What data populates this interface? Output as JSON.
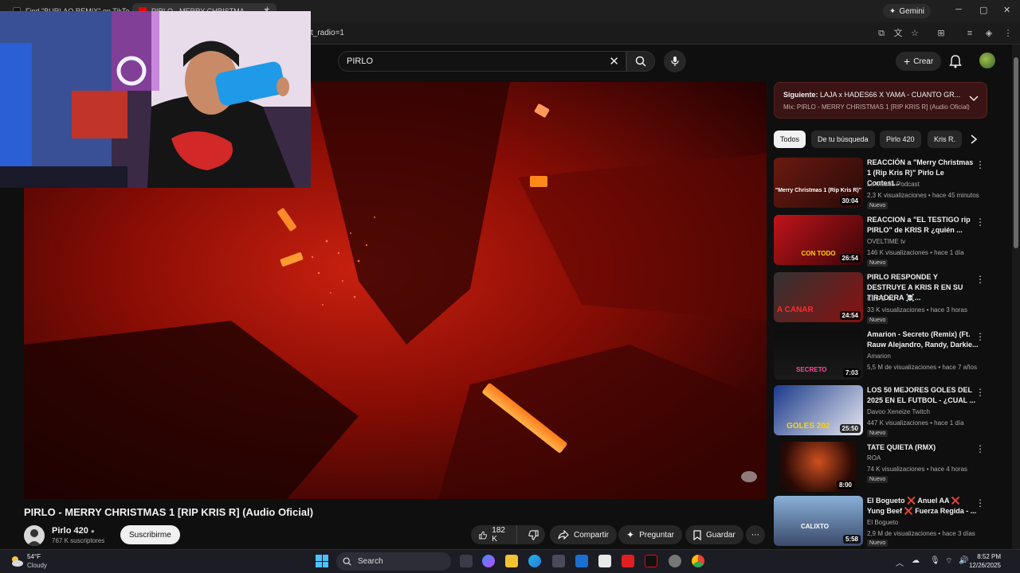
{
  "browser": {
    "tabs": [
      {
        "label": "Find \"BURLAO REMIX\" on TikTo..."
      },
      {
        "label": "PIRLO - MERRY CHRISTMA..."
      }
    ],
    "gemini_label": "Gemini",
    "url_fragment": "t_radio=1"
  },
  "youtube": {
    "search_value": "PIRLO",
    "create_label": "Crear"
  },
  "video": {
    "title": "PIRLO - MERRY CHRISTMAS 1 [RIP KRIS R] (Audio Oficial)",
    "channel_name": "Pirlo 420",
    "subscribers": "767 K suscriptores",
    "subscribe_label": "Suscribirme",
    "likes": "182 K",
    "share_label": "Compartir",
    "ask_label": "Preguntar",
    "save_label": "Guardar"
  },
  "up_next": {
    "prefix": "Siguiente:",
    "title": "LAJA x HADES66 X YAMA - CUANTO GR...",
    "mix": "Mix: PIRLO - MERRY CHRISTMAS 1 [RIP KRIS R] (Audio Oficial)"
  },
  "chips": [
    "Todos",
    "De tu búsqueda",
    "Pirlo 420",
    "Kris R."
  ],
  "recommendations": [
    {
      "title": "REACCIÓN a \"Merry Christmas 1 (Rip Kris R)\" Pirlo Le Contest...",
      "channel": "La Mesita Podcast",
      "meta": "2,3 K visualizaciones • hace 45 minutos",
      "badge": "Nuevo",
      "duration": "30:04",
      "thumb_text": "\"Merry Christmas 1 (Rip Kris R)\""
    },
    {
      "title": "REACCION a \"EL TESTIGO rip PIRLO\" de KRIS R ¿quién ...",
      "channel": "OVELTIME tv",
      "meta": "146 K visualizaciones • hace 1 día",
      "badge": "Nuevo",
      "duration": "26:54",
      "thumb_text": "CON TODO"
    },
    {
      "title": "PIRLO RESPONDE Y DESTRUYE A KRIS R EN SU TIRADERA ☠️...",
      "channel": "CLIPS TC",
      "meta": "33 K visualizaciones • hace 3 horas",
      "badge": "Nuevo",
      "duration": "24:54",
      "thumb_text": "A CANAR"
    },
    {
      "title": "Amarion - Secreto (Remix) (Ft. Rauw Alejandro, Randy, Darkie...",
      "channel": "Amarion",
      "meta": "5,5 M de visualizaciones • hace 7 años",
      "badge": "",
      "duration": "7:03",
      "thumb_text": "SECRETO"
    },
    {
      "title": "LOS 50 MEJORES GOLES DEL 2025 EN EL FUTBOL - ¿CUAL ...",
      "channel": "Davoo Xeneize Twitch",
      "meta": "447 K visualizaciones • hace 1 día",
      "badge": "Nuevo",
      "duration": "25:50",
      "thumb_text": "GOLES 202"
    },
    {
      "title": "TATE QUIETA (RMX)",
      "channel": "ROA",
      "meta": "74 K visualizaciones • hace 4 horas",
      "badge": "Nuevo",
      "duration": "8:00",
      "thumb_text": ""
    },
    {
      "title": "El Bogueto ❌ Anuel AA ❌ Yung Beef ❌ Fuerza Regida - ...",
      "channel": "El Bogueto",
      "meta": "2,9 M de visualizaciones • hace 3 días",
      "badge": "Nuevo",
      "duration": "5:58",
      "thumb_text": "CALIXTO"
    }
  ],
  "taskbar": {
    "temperature": "54°F",
    "condition": "Cloudy",
    "search_label": "Search",
    "time": "8:52 PM",
    "date": "12/26/2025"
  },
  "colors": {
    "background": "#0f0f0f",
    "upnext_bg": "#3a1414",
    "video_red": "#b01a0a",
    "windows_accent": "#4cc2ff"
  }
}
